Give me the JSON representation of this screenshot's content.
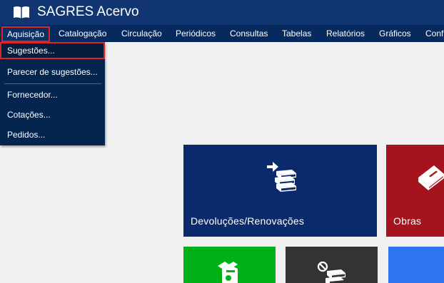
{
  "app": {
    "title": "SAGRES Acervo"
  },
  "menubar": {
    "items": [
      {
        "label": "Aquisição",
        "active": true
      },
      {
        "label": "Catalogação"
      },
      {
        "label": "Circulação"
      },
      {
        "label": "Periódicos"
      },
      {
        "label": "Consultas"
      },
      {
        "label": "Tabelas"
      },
      {
        "label": "Relatórios"
      },
      {
        "label": "Gráficos"
      },
      {
        "label": "Conf"
      }
    ]
  },
  "dropdown": {
    "items": [
      {
        "label": "Sugestões...",
        "highlighted": true
      },
      {
        "label": "Parecer de sugestões..."
      },
      {
        "label": "Fornecedor..."
      },
      {
        "label": "Cotações..."
      },
      {
        "label": "Pedidos..."
      }
    ]
  },
  "tiles": [
    {
      "label": "Devoluções/Renovações",
      "icon": "books-return-icon",
      "color": "#0b2a6b"
    },
    {
      "label": "Obras",
      "icon": "book-icon",
      "color": "#a5131d"
    },
    {
      "label": "",
      "icon": "book-alt-icon",
      "color": "#00b016"
    },
    {
      "label": "",
      "icon": "books-blocked-icon",
      "color": "#333333"
    },
    {
      "label": "",
      "icon": "",
      "color": "#2d74f0"
    }
  ],
  "colors": {
    "titlebar": "#113570",
    "menubar": "#072a5e",
    "dropdown": "#03254e",
    "background": "#f0f0f0",
    "highlight_border": "#e02424"
  }
}
